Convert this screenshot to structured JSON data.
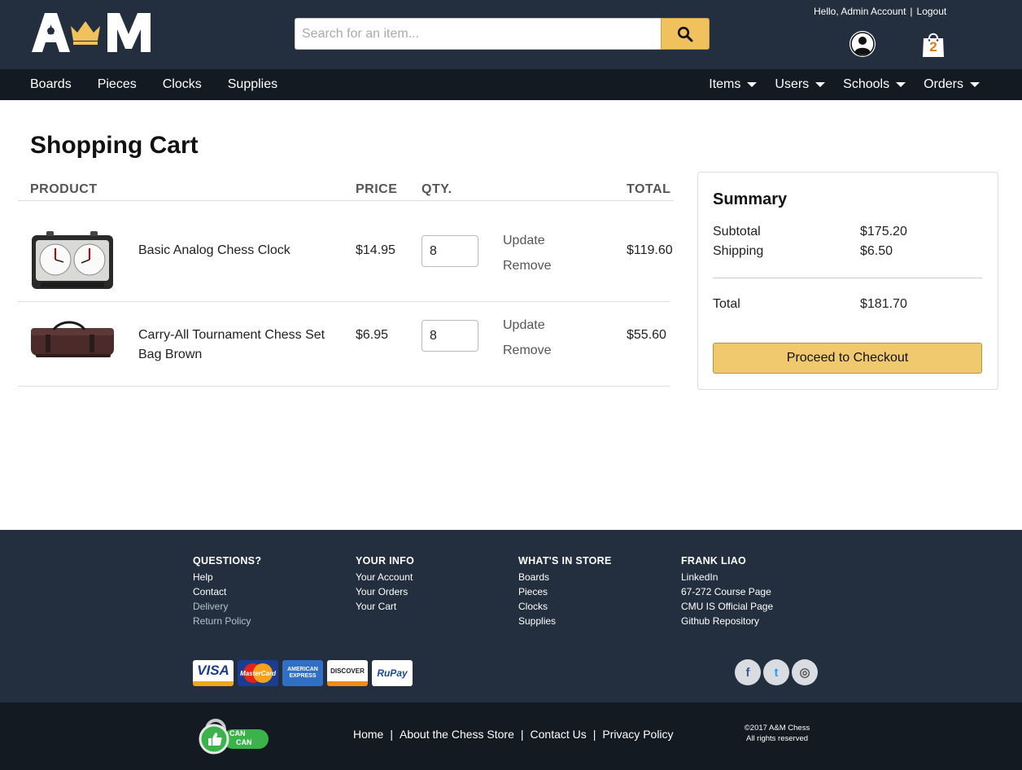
{
  "header": {
    "logo_text": "A♔M",
    "search_placeholder": "Search for an item...",
    "greeting": "Hello, Admin Account",
    "greeting_sep": "|",
    "logout": "Logout",
    "cart_count": "2"
  },
  "nav": {
    "left": [
      "Boards",
      "Pieces",
      "Clocks",
      "Supplies"
    ],
    "right": [
      "Items",
      "Users",
      "Schools",
      "Orders"
    ]
  },
  "cart": {
    "title": "Shopping Cart",
    "columns": [
      "PRODUCT",
      "PRICE",
      "QTY.",
      "TOTAL"
    ],
    "items": [
      {
        "name": "Basic Analog Chess Clock",
        "price": "$14.95",
        "qty": "8",
        "update": "Update",
        "remove": "Remove",
        "total": "$119.60"
      },
      {
        "name": "Carry-All Tournament Chess Set Bag Brown",
        "price": "$6.95",
        "qty": "8",
        "update": "Update",
        "remove": "Remove",
        "total": "$55.60"
      }
    ]
  },
  "summary": {
    "title": "Summary",
    "subtotal_label": "Subtotal",
    "subtotal": "$175.20",
    "shipping_label": "Shipping",
    "shipping": "$6.50",
    "total_label": "Total",
    "total": "$181.70",
    "checkout": "Proceed to Checkout"
  },
  "footer": {
    "columns": [
      {
        "heading": "QUESTIONS?",
        "items": [
          "Help",
          "Contact",
          "Delivery",
          "Return Policy"
        ]
      },
      {
        "heading": "YOUR INFO",
        "items": [
          "Your Account",
          "Your Orders",
          "Your Cart"
        ]
      },
      {
        "heading": "WHAT'S IN STORE",
        "items": [
          "Boards",
          "Pieces",
          "Clocks",
          "Supplies"
        ]
      },
      {
        "heading": "FRANK LIAO",
        "items": [
          "LinkedIn",
          "67-272 Course Page",
          "CMU IS Official Page",
          "Github Repository"
        ]
      }
    ],
    "cards": [
      "VISA",
      "MasterCard",
      "AMERICAN EXPRESS",
      "DISCOVER",
      "RuPay"
    ],
    "social": [
      "f",
      "t",
      "◎"
    ],
    "badge": [
      "CAN",
      "CAN"
    ],
    "links": [
      "Home",
      "About the Chess Store",
      "Contact Us",
      "Privacy Policy"
    ],
    "link_sep": "|",
    "copyright_1": "©2017 A&M Chess",
    "copyright_2": "All rights reserved"
  },
  "colors": {
    "header_bg": "#232f3e",
    "nav_bg": "#131a22",
    "accent_yellow": "#f0c15d",
    "cart_badge": "#e07b12"
  }
}
